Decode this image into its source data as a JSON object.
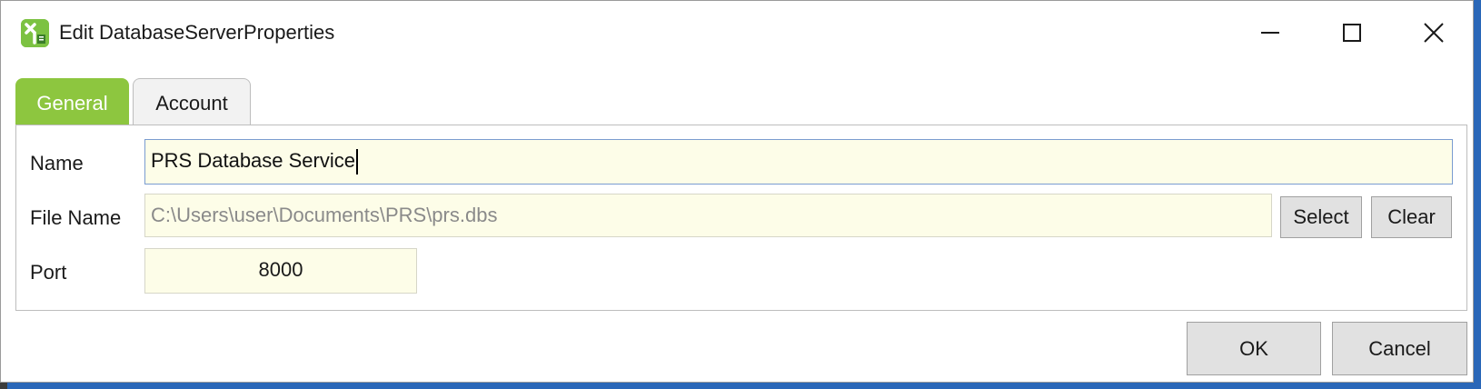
{
  "window": {
    "title": "Edit DatabaseServerProperties",
    "icon": "app-x-icon",
    "controls": [
      "minimize-icon",
      "maximize-icon",
      "close-icon"
    ]
  },
  "tabs": [
    {
      "label": "General",
      "active": true
    },
    {
      "label": "Account",
      "active": false
    }
  ],
  "form": {
    "name_label": "Name",
    "name_value": "PRS Database Service",
    "file_label": "File Name",
    "file_value": "C:\\Users\\user\\Documents\\PRS\\prs.dbs",
    "select_label": "Select",
    "clear_label": "Clear",
    "port_label": "Port",
    "port_value": "8000"
  },
  "footer": {
    "ok_label": "OK",
    "cancel_label": "Cancel"
  },
  "colors": {
    "accent": "#8dc63f",
    "field_bg": "#fdfde8",
    "button_bg": "#e1e1e1"
  }
}
